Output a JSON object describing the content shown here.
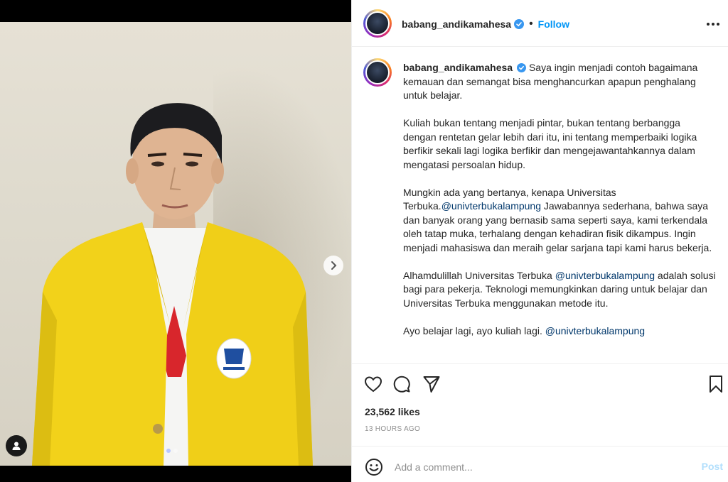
{
  "post": {
    "username": "babang_andikamahesa",
    "follow_label": "Follow",
    "dot": "•",
    "likes": "23,562 likes",
    "time_ago": "13 HOURS AGO",
    "comment_placeholder": "Add a comment...",
    "post_label": "Post"
  },
  "caption": {
    "p1": "Saya ingin menjadi contoh bagaimana kemauan dan semangat bisa menghancurkan apapun penghalang untuk belajar.",
    "p2": "Kuliah bukan tentang menjadi pintar, bukan tentang berbangga dengan rentetan gelar lebih dari itu, ini tentang memperbaiki logika berfikir sekali lagi logika berfikir dan mengejawantahkannya dalam mengatasi persoalan hidup.",
    "p3_a": "Mungkin ada yang bertanya, kenapa Universitas Terbuka.",
    "p3_mention": "@univterbukalampung",
    "p3_b": " Jawabannya sederhana, bahwa saya dan banyak orang yang bernasib sama seperti saya, kami terkendala oleh tatap muka, terhalang dengan kehadiran fisik dikampus. Ingin menjadi mahasiswa dan meraih gelar sarjana tapi kami harus bekerja.",
    "p4_a": "Alhamdulillah Universitas Terbuka ",
    "p4_mention": "@univterbukalampung",
    "p4_b": " adalah solusi bagi para pekerja. Teknologi memungkinkan daring untuk belajar dan Universitas Terbuka menggunakan metode itu.",
    "p5_a": "Ayo belajar lagi, ayo kuliah lagi. ",
    "p5_mention": "@univterbukalampung"
  },
  "icons": {
    "verified": "verified-badge-icon",
    "more": "more-options-icon",
    "like": "heart-icon",
    "comment": "comment-bubble-icon",
    "share": "paper-plane-icon",
    "save": "bookmark-icon",
    "emoji": "smiley-icon",
    "next": "chevron-right-icon",
    "tag": "user-tag-icon"
  },
  "carousel": {
    "slides": 2,
    "active": 1
  },
  "colors": {
    "accent": "#0095f6",
    "verified": "#3897f0",
    "mention": "#00376b",
    "post_disabled": "#b2dffc",
    "jacket": "#f2d21a"
  }
}
